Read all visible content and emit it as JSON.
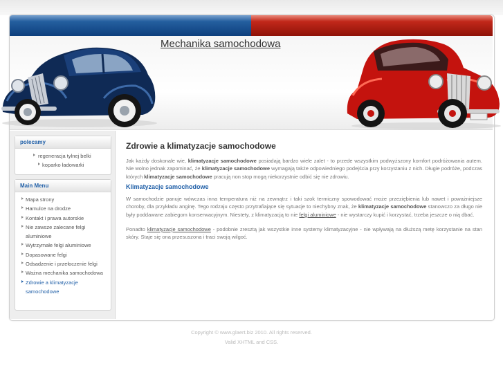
{
  "header": {
    "site_title": "Mechanika samochodowa"
  },
  "sidebar": {
    "polecamy": {
      "title": "polecamy",
      "items": [
        {
          "label": "regeneracja tylnej belki"
        },
        {
          "label": "koparko ładowarki"
        }
      ]
    },
    "main_menu": {
      "title": "Main Menu",
      "items": [
        {
          "label": "Mapa strony"
        },
        {
          "label": "Hamulce na drodze"
        },
        {
          "label": "Kontakt i prawa autorskie"
        },
        {
          "label": "Nie zawsze zalecane felgi aluminiowe"
        },
        {
          "label": "Wytrzymałe felgi aluminiowe"
        },
        {
          "label": "Dopasowane felgi"
        },
        {
          "label": "Odsadzenie i przełoczenie felgi"
        },
        {
          "label": "Ważna mechanika samochodowa"
        },
        {
          "label": "Zdrowie a klimatyzacje samochodowe"
        }
      ],
      "active_index": 8
    }
  },
  "main": {
    "title": "Zdrowie a klimatyzacje samochodowe",
    "p1": {
      "t1": "Jak każdy doskonale wie, ",
      "b1": "klimatyzacje samochodowe",
      "t2": " posiadają bardzo wiele zalet - to przede wszystkim podwyższony komfort podróżowania autem. Nie wolno jednak zapominać, że ",
      "b2": "klimatyzacje samochodowe",
      "t3": " wymagają także odpowiedniego podejścia przy korzystaniu z nich. Długie podróże, podczas których ",
      "b3": "klimatyzacje samochodowe",
      "t4": " pracują non stop mogą niekorzystnie odbić się nie zdrowiu."
    },
    "subheading": "Klimatyzacje samochodowe",
    "p2": {
      "t1": "W samochodzie panuje wówczas inna temperatura niż na zewnątrz i taki szok termiczny spowodować może przeziębienia lub nawet i poważniejsze choroby, dla przykładu anginę. Tego rodzaju często przytrafiające się sytuacje to niechybny znak, że ",
      "b1": "klimatyzacje samochodowe",
      "t2": " stanowczo za długo nie były poddawane zabiegom konserwacyjnym. Niestety, z klimatyzacją to nie ",
      "l1": "felgi aluminiowe",
      "t3": " - nie wystarczy kupić i korzystać, trzeba jeszcze o nią dbać."
    },
    "p3": {
      "t1": "Ponadto ",
      "l1": "klimatyzacje samochodowe",
      "t2": " - podobnie zresztą jak wszystkie inne systemy klimatyzacyjne - nie wpływają na dłuższą metę korzystanie na stan skóry. Staje się ona przesuszona i traci swoją wilgoć."
    }
  },
  "footer": {
    "copyright_prefix": "Copyright © ",
    "copyright_link": "www.glaert.biz",
    "copyright_suffix": " 2010. All rights reserved.",
    "valid_prefix": "Valid ",
    "xhtml": "XHTML",
    "and": " and ",
    "css": "CSS",
    "valid_suffix": "."
  },
  "colors": {
    "accent_blue": "#2160a8",
    "header_blue": "#245f9f",
    "header_red": "#c2281a"
  }
}
